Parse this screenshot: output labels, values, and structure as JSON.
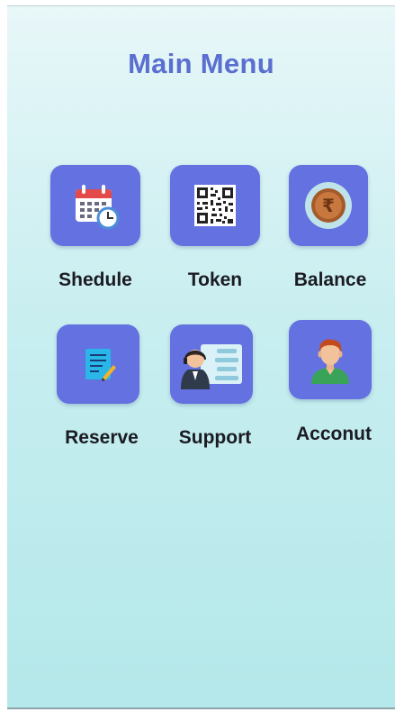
{
  "header": {
    "title": "Main Menu"
  },
  "menu": {
    "items": [
      {
        "label": "Shedule",
        "icon": "calendar-clock-icon"
      },
      {
        "label": "Token",
        "icon": "qr-code-icon"
      },
      {
        "label": "Balance",
        "icon": "rupee-coin-icon"
      },
      {
        "label": "Reserve",
        "icon": "document-edit-icon"
      },
      {
        "label": "Support",
        "icon": "support-agent-icon"
      },
      {
        "label": "Acconut",
        "icon": "user-avatar-icon"
      }
    ]
  },
  "colors": {
    "title": "#5a6fd0",
    "tile_background": "#6471e0",
    "background_top": "#e8f7f8",
    "background_bottom": "#b4e8ea",
    "label": "#1b1b22"
  }
}
